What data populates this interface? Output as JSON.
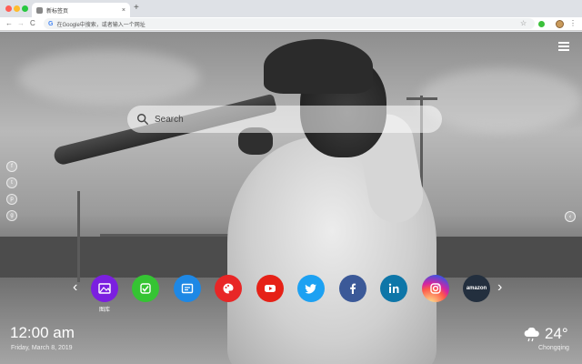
{
  "browser": {
    "tab_title": "新标签页",
    "tab_close": "×",
    "new_tab": "+",
    "back": "←",
    "forward": "→",
    "reload": "C",
    "omnibox_g": "G",
    "omnibox_text": "在Google中搜索，或者输入一个网址",
    "star": "☆",
    "menu": "⋮"
  },
  "search": {
    "placeholder": "Search"
  },
  "social": [
    {
      "icon": "facebook-icon",
      "glyph": "f"
    },
    {
      "icon": "twitter-icon",
      "glyph": "t"
    },
    {
      "icon": "pinterest-icon",
      "glyph": "p"
    },
    {
      "icon": "google-plus-icon",
      "glyph": "g"
    }
  ],
  "right_toggle": "‹",
  "nav": {
    "prev": "‹",
    "next": "›"
  },
  "shortcuts": [
    {
      "name": "gallery",
      "label": "图库",
      "color": "#7b1fe0"
    },
    {
      "name": "tasks",
      "label": "",
      "color": "#35c433"
    },
    {
      "name": "notes",
      "label": "",
      "color": "#1e88e5"
    },
    {
      "name": "paint",
      "label": "",
      "color": "#e82626"
    },
    {
      "name": "youtube",
      "label": "",
      "color": "#e62117"
    },
    {
      "name": "twitter",
      "label": "",
      "color": "#1da1f2"
    },
    {
      "name": "facebook",
      "label": "",
      "color": "#3b5998"
    },
    {
      "name": "linkedin",
      "label": "",
      "color": "#0e76a8"
    },
    {
      "name": "instagram",
      "label": "",
      "color": "#d6249f"
    },
    {
      "name": "amazon",
      "label": "",
      "color": "#232f3e",
      "text": "amazon"
    }
  ],
  "clock": {
    "time": "12:00 am",
    "date": "Friday, March 8, 2019"
  },
  "weather": {
    "temp": "24°",
    "city": "Chongqing",
    "icon": "cloud-rain-icon"
  }
}
